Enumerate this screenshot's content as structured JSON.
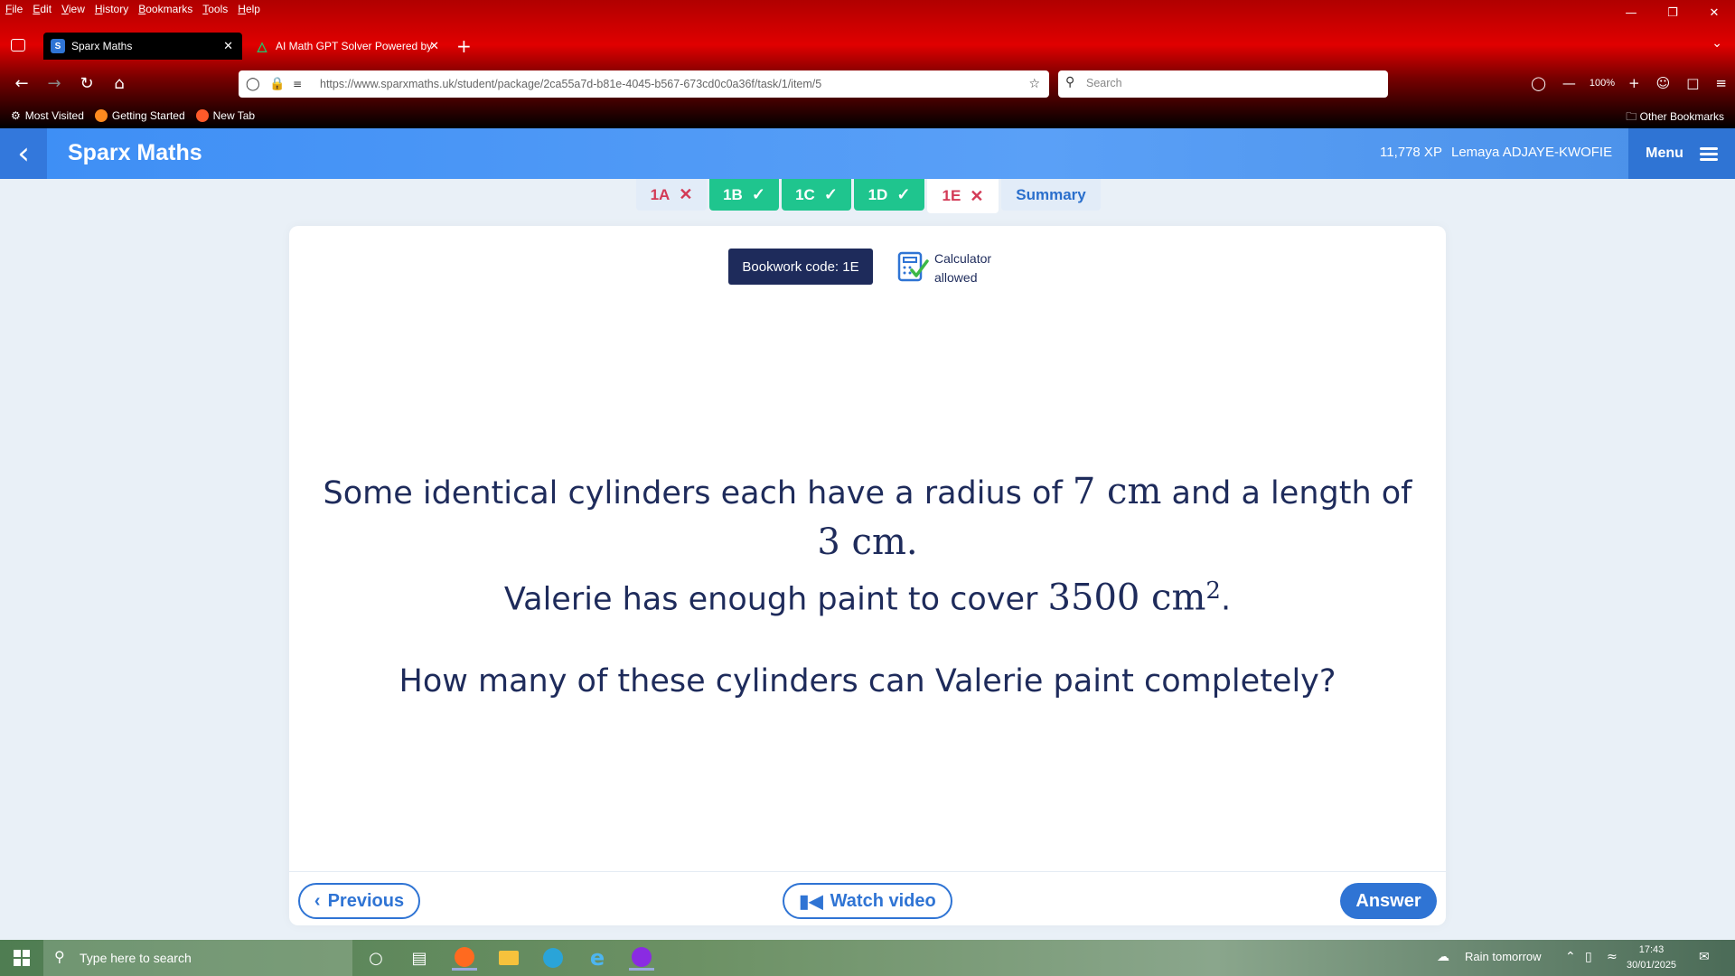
{
  "browser": {
    "menu": [
      "File",
      "Edit",
      "View",
      "History",
      "Bookmarks",
      "Tools",
      "Help"
    ],
    "tabs": [
      {
        "title": "Sparx Maths",
        "favicon": "S"
      },
      {
        "title": "AI Math GPT Solver Powered by"
      }
    ],
    "url": "https://www.sparxmaths.uk/student/package/2ca55a7d-b81e-4045-b567-673cd0c0a36f/task/1/item/5",
    "search_placeholder": "Search",
    "zoom": "100%",
    "bookmarks": [
      "Most Visited",
      "Getting Started",
      "New Tab"
    ],
    "other_bookmarks": "Other Bookmarks"
  },
  "header": {
    "brand": "Sparx Maths",
    "xp": "11,778 XP",
    "user": "Lemaya ADJAYE-KWOFIE",
    "menu_label": "Menu"
  },
  "task_tabs": [
    {
      "label": "1A",
      "status": "wrong"
    },
    {
      "label": "1B",
      "status": "correct"
    },
    {
      "label": "1C",
      "status": "correct"
    },
    {
      "label": "1D",
      "status": "correct"
    },
    {
      "label": "1E",
      "status": "wrong-current"
    },
    {
      "label": "Summary",
      "status": "summary"
    }
  ],
  "question_card": {
    "bookwork_code": "Bookwork code: 1E",
    "calculator_line1": "Calculator",
    "calculator_line2": "allowed",
    "q_text1": "Some identical cylinders each have a radius of ",
    "q_radius": "7 cm",
    "q_text2": " and a length of",
    "q_length": "3 cm.",
    "q_text3": "Valerie has enough paint to cover ",
    "q_area": "3500 cm",
    "q_area_power": "2",
    "q_text4": ".",
    "q_question": "How many of these cylinders can Valerie paint completely?"
  },
  "footer": {
    "previous": "Previous",
    "watch_video": "Watch video",
    "answer": "Answer"
  },
  "taskbar": {
    "search_placeholder": "Type here to search",
    "weather": "Rain tomorrow",
    "time": "17:43",
    "date": "30/01/2025"
  },
  "colors": {
    "header_blue": "#3d8ef5",
    "correct_green": "#1fc58e",
    "wrong_red": "#d33a56",
    "navy": "#1e2b5b",
    "button_blue": "#2f74d4"
  }
}
